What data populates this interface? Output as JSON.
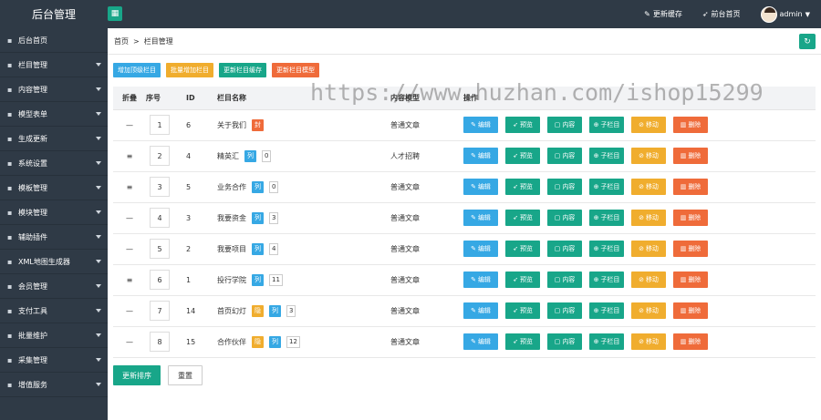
{
  "header": {
    "brand": "后台管理",
    "links": [
      {
        "icon": "edit-icon",
        "label": "更新缓存"
      },
      {
        "icon": "send-icon",
        "label": "前台首页"
      }
    ],
    "user": "admin"
  },
  "sidebar": {
    "items": [
      {
        "icon": "home-icon",
        "label": "后台首页",
        "has_sub": false
      },
      {
        "icon": "list-icon",
        "label": "栏目管理",
        "has_sub": true
      },
      {
        "icon": "doc-icon",
        "label": "内容管理",
        "has_sub": true
      },
      {
        "icon": "model-icon",
        "label": "模型表单",
        "has_sub": true
      },
      {
        "icon": "refresh-icon",
        "label": "生成更新",
        "has_sub": true
      },
      {
        "icon": "gear-icon",
        "label": "系统设置",
        "has_sub": true
      },
      {
        "icon": "template-icon",
        "label": "模板管理",
        "has_sub": true
      },
      {
        "icon": "block-icon",
        "label": "模块管理",
        "has_sub": true
      },
      {
        "icon": "plugin-icon",
        "label": "辅助插件",
        "has_sub": true
      },
      {
        "icon": "sitemap-icon",
        "label": "XML地图生成器",
        "has_sub": true
      },
      {
        "icon": "user-icon",
        "label": "会员管理",
        "has_sub": true
      },
      {
        "icon": "pay-icon",
        "label": "支付工具",
        "has_sub": true
      },
      {
        "icon": "batch-icon",
        "label": "批量维护",
        "has_sub": true
      },
      {
        "icon": "collect-icon",
        "label": "采集管理",
        "has_sub": true
      },
      {
        "icon": "service-icon",
        "label": "增值服务",
        "has_sub": true
      }
    ]
  },
  "breadcrumb": {
    "home": "首页",
    "sep": ">",
    "current": "栏目管理"
  },
  "actions": [
    {
      "label": "增加顶级栏目",
      "color": "blue"
    },
    {
      "label": "批量增加栏目",
      "color": "orange"
    },
    {
      "label": "更新栏目缓存",
      "color": "green"
    },
    {
      "label": "更新栏目模型",
      "color": "red"
    }
  ],
  "table": {
    "headers": {
      "fold": "折叠",
      "sort": "序号",
      "id": "ID",
      "name": "栏目名称",
      "model": "内容模型",
      "ops": "操作"
    },
    "rows": [
      {
        "fold": "—",
        "sort": "1",
        "id": "6",
        "name": "关于我们",
        "tags": [
          {
            "text": "封",
            "color": "red"
          }
        ],
        "count": "",
        "model": "普通文章"
      },
      {
        "fold": "≡",
        "sort": "2",
        "id": "4",
        "name": "精英汇",
        "tags": [
          {
            "text": "列",
            "color": "blue"
          }
        ],
        "count": "0",
        "model": "人才招聘"
      },
      {
        "fold": "≡",
        "sort": "3",
        "id": "5",
        "name": "业务合作",
        "tags": [
          {
            "text": "列",
            "color": "blue"
          }
        ],
        "count": "0",
        "model": "普通文章"
      },
      {
        "fold": "—",
        "sort": "4",
        "id": "3",
        "name": "我要资金",
        "tags": [
          {
            "text": "列",
            "color": "blue"
          }
        ],
        "count": "3",
        "model": "普通文章"
      },
      {
        "fold": "—",
        "sort": "5",
        "id": "2",
        "name": "我要项目",
        "tags": [
          {
            "text": "列",
            "color": "blue"
          }
        ],
        "count": "4",
        "model": "普通文章"
      },
      {
        "fold": "≡",
        "sort": "6",
        "id": "1",
        "name": "投行学院",
        "tags": [
          {
            "text": "列",
            "color": "blue"
          }
        ],
        "count": "11",
        "model": "普通文章"
      },
      {
        "fold": "—",
        "sort": "7",
        "id": "14",
        "name": "首页幻灯",
        "tags": [
          {
            "text": "隐",
            "color": "orange"
          },
          {
            "text": "列",
            "color": "blue"
          }
        ],
        "count": "3",
        "model": "普通文章"
      },
      {
        "fold": "—",
        "sort": "8",
        "id": "15",
        "name": "合作伙伴",
        "tags": [
          {
            "text": "隐",
            "color": "orange"
          },
          {
            "text": "列",
            "color": "blue"
          }
        ],
        "count": "12",
        "model": "普通文章"
      }
    ],
    "row_ops": [
      {
        "icon": "pencil-icon",
        "glyph": "✎",
        "label": "编辑",
        "color": "blue"
      },
      {
        "icon": "plane-icon",
        "glyph": "➶",
        "label": "预览",
        "color": "green"
      },
      {
        "icon": "doc-icon",
        "glyph": "▢",
        "label": "内容",
        "color": "green"
      },
      {
        "icon": "plus-circle-icon",
        "glyph": "⊕",
        "label": "子栏目",
        "color": "green"
      },
      {
        "icon": "move-icon",
        "glyph": "⊘",
        "label": "移动",
        "color": "orange"
      },
      {
        "icon": "trash-icon",
        "glyph": "▥",
        "label": "删除",
        "color": "red"
      }
    ]
  },
  "bottom": {
    "save": "更新排序",
    "reset": "重置"
  },
  "watermark": "https://www.huzhan.com/ishop15299",
  "colors": {
    "dark": "#2f3a46",
    "green": "#18a689",
    "blue": "#36a8e4",
    "orange": "#f0ad2e",
    "red": "#ef6b3a"
  }
}
